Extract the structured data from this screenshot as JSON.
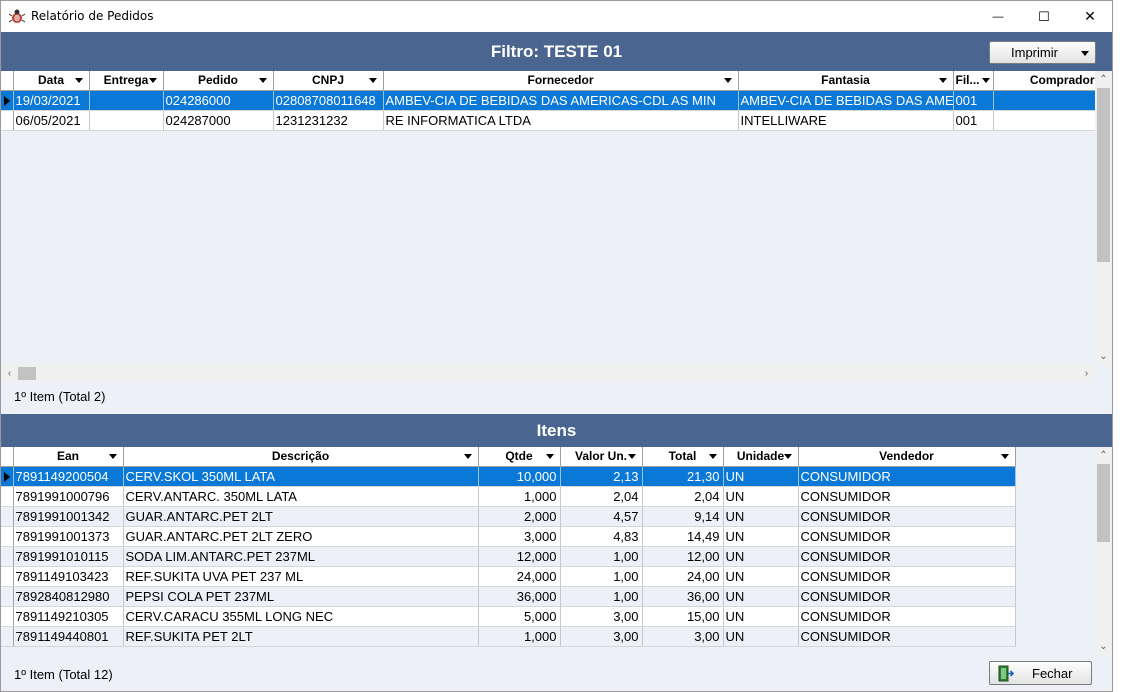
{
  "window": {
    "title": "Relatório de Pedidos",
    "minimize_glyph": "—",
    "maximize_glyph": "☐",
    "close_glyph": "✕"
  },
  "orders": {
    "header": "Filtro: TESTE 01",
    "print_label": "Imprimir",
    "columns": [
      "Data",
      "Entrega",
      "Pedido",
      "CNPJ",
      "Fornecedor",
      "Fantasia",
      "Fil...",
      "Comprador"
    ],
    "rows": [
      {
        "data": "19/03/2021",
        "entrega": "",
        "pedido": "024286000",
        "cnpj": "02808708011648",
        "fornecedor": "AMBEV-CIA DE BEBIDAS DAS AMERICAS-CDL AS MIN",
        "fantasia": "AMBEV-CIA DE BEBIDAS DAS AME",
        "filial": "001",
        "comprador": "",
        "selected": true
      },
      {
        "data": "06/05/2021",
        "entrega": "",
        "pedido": "024287000",
        "cnpj": "1231231232",
        "fornecedor": "RE INFORMATICA LTDA",
        "fantasia": "INTELLIWARE",
        "filial": "001",
        "comprador": "",
        "selected": false
      }
    ],
    "status": "1º Item (Total 2)"
  },
  "items": {
    "header": "Itens",
    "columns": [
      "Ean",
      "Descrição",
      "Qtde",
      "Valor Un.",
      "Total",
      "Unidade",
      "Vendedor"
    ],
    "rows": [
      {
        "ean": "7891149200504",
        "descricao": "CERV.SKOL 350ML LATA",
        "qtde": "10,000",
        "valor": "2,13",
        "total": "21,30",
        "unidade": "UN",
        "vendedor": "CONSUMIDOR",
        "selected": true
      },
      {
        "ean": "7891991000796",
        "descricao": "CERV.ANTARC. 350ML LATA",
        "qtde": "1,000",
        "valor": "2,04",
        "total": "2,04",
        "unidade": "UN",
        "vendedor": "CONSUMIDOR",
        "selected": false
      },
      {
        "ean": "7891991001342",
        "descricao": "GUAR.ANTARC.PET 2LT",
        "qtde": "2,000",
        "valor": "4,57",
        "total": "9,14",
        "unidade": "UN",
        "vendedor": "CONSUMIDOR",
        "selected": false
      },
      {
        "ean": "7891991001373",
        "descricao": "GUAR.ANTARC.PET 2LT ZERO",
        "qtde": "3,000",
        "valor": "4,83",
        "total": "14,49",
        "unidade": "UN",
        "vendedor": "CONSUMIDOR",
        "selected": false
      },
      {
        "ean": "7891991010115",
        "descricao": "SODA LIM.ANTARC.PET 237ML",
        "qtde": "12,000",
        "valor": "1,00",
        "total": "12,00",
        "unidade": "UN",
        "vendedor": "CONSUMIDOR",
        "selected": false
      },
      {
        "ean": "7891149103423",
        "descricao": "REF.SUKITA UVA PET 237 ML",
        "qtde": "24,000",
        "valor": "1,00",
        "total": "24,00",
        "unidade": "UN",
        "vendedor": "CONSUMIDOR",
        "selected": false
      },
      {
        "ean": "7892840812980",
        "descricao": "PEPSI COLA PET 237ML",
        "qtde": "36,000",
        "valor": "1,00",
        "total": "36,00",
        "unidade": "UN",
        "vendedor": "CONSUMIDOR",
        "selected": false
      },
      {
        "ean": "7891149210305",
        "descricao": "CERV.CARACU 355ML LONG NEC",
        "qtde": "5,000",
        "valor": "3,00",
        "total": "15,00",
        "unidade": "UN",
        "vendedor": "CONSUMIDOR",
        "selected": false
      },
      {
        "ean": "7891149440801",
        "descricao": "REF.SUKITA PET 2LT",
        "qtde": "1,000",
        "valor": "3,00",
        "total": "3,00",
        "unidade": "UN",
        "vendedor": "CONSUMIDOR",
        "selected": false
      }
    ],
    "status": "1º Item (Total 12)",
    "close_label": "Fechar"
  },
  "colors": {
    "header_bar": "#4a6590",
    "selection": "#0a78d7",
    "alt_row": "#eef0f8"
  },
  "icons": {
    "app": "bug-icon",
    "print_dropdown": "chevron-down-icon",
    "close_button": "exit-door-icon"
  }
}
